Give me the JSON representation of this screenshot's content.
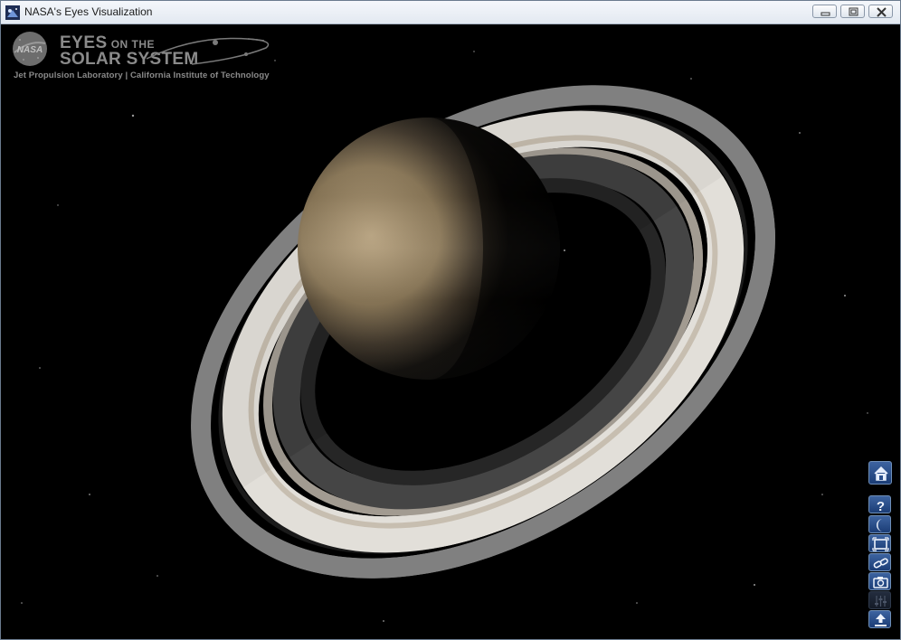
{
  "window": {
    "title": "NASA's Eyes Visualization",
    "controls": [
      "minimize",
      "restore",
      "close"
    ]
  },
  "logo": {
    "agency": "NASA",
    "line1_main": "EYES",
    "line1_small": "ON THE",
    "line2": "SOLAR SYSTEM",
    "subtitle": "Jet Propulsion Laboratory | California Institute of Technology"
  },
  "toolbar": {
    "buttons": [
      {
        "name": "home",
        "icon": "home-icon"
      },
      {
        "name": "help",
        "icon": "question-icon"
      },
      {
        "name": "moon",
        "icon": "crescent-moon-icon"
      },
      {
        "name": "fullscreen",
        "icon": "fullscreen-icon"
      },
      {
        "name": "link",
        "icon": "chain-link-icon"
      },
      {
        "name": "screenshot",
        "icon": "camera-icon"
      },
      {
        "name": "settings",
        "icon": "sliders-icon",
        "state": "disabled"
      },
      {
        "name": "upload",
        "icon": "upload-icon"
      }
    ]
  },
  "colors": {
    "toolbar_button": "#2a4f8d",
    "space": "#000000",
    "logo_gray": "#8a8a8a"
  }
}
